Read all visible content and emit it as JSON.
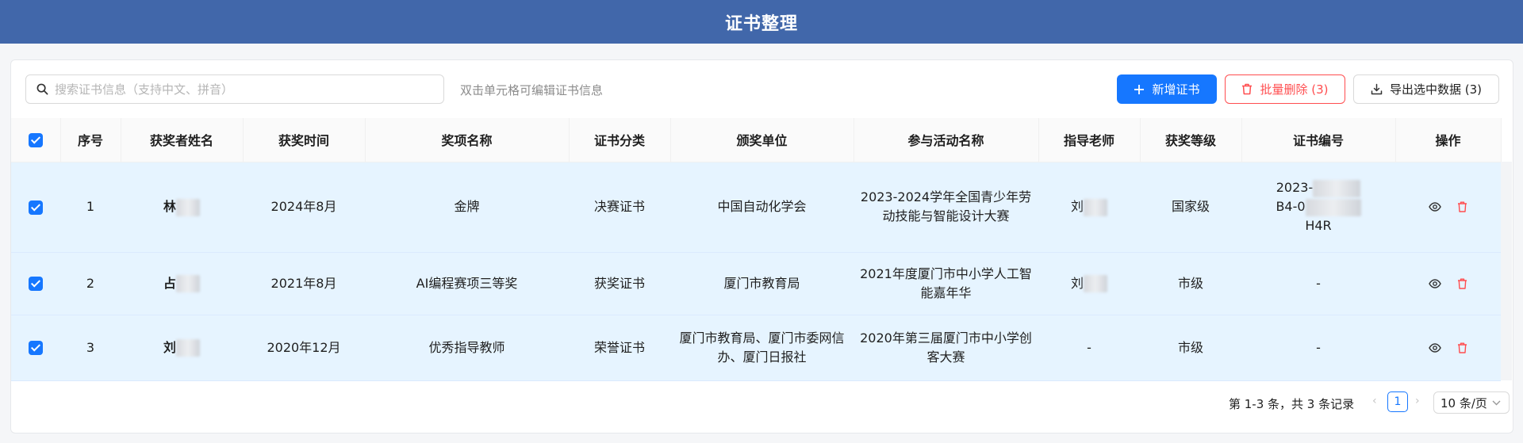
{
  "app": {
    "title": "证书整理"
  },
  "toolbar": {
    "search_placeholder": "搜索证书信息（支持中文、拼音）",
    "hint": "双击单元格可编辑证书信息",
    "add_label": "新增证书",
    "delete_label": "批量删除 (3)",
    "export_label": "导出选中数据 (3)"
  },
  "table": {
    "columns": [
      "序号",
      "获奖者姓名",
      "获奖时间",
      "奖项名称",
      "证书分类",
      "颁奖单位",
      "参与活动名称",
      "指导老师",
      "获奖等级",
      "证书编号",
      "操作"
    ],
    "rows": [
      {
        "index": "1",
        "name": "林",
        "time": "2024年8月",
        "award": "金牌",
        "category": "决赛证书",
        "issuer": "中国自动化学会",
        "activity": "2023-2024学年全国青少年劳动技能与智能设计大赛",
        "teacher": "刘",
        "level": "国家级",
        "cert_no_1": "2023-",
        "cert_no_2": "B4-0",
        "cert_no_3": "H4R"
      },
      {
        "index": "2",
        "name": "占",
        "time": "2021年8月",
        "award": "AI编程赛项三等奖",
        "category": "获奖证书",
        "issuer": "厦门市教育局",
        "activity": "2021年度厦门市中小学人工智能嘉年华",
        "teacher": "刘",
        "level": "市级",
        "cert_no": "-"
      },
      {
        "index": "3",
        "name": "刘",
        "time": "2020年12月",
        "award": "优秀指导教师",
        "category": "荣誉证书",
        "issuer": "厦门市教育局、厦门市委网信办、厦门日报社",
        "activity": "2020年第三届厦门市中小学创客大赛",
        "teacher": "-",
        "level": "市级",
        "cert_no": "-"
      }
    ]
  },
  "pagination": {
    "total_text": "第 1-3 条，共 3 条记录",
    "current_page": "1",
    "page_size": "10 条/页"
  },
  "colors": {
    "header_bg": "#4167aa",
    "primary": "#1677ff",
    "danger": "#ff4d4f",
    "row_selected": "#e6f4ff"
  }
}
